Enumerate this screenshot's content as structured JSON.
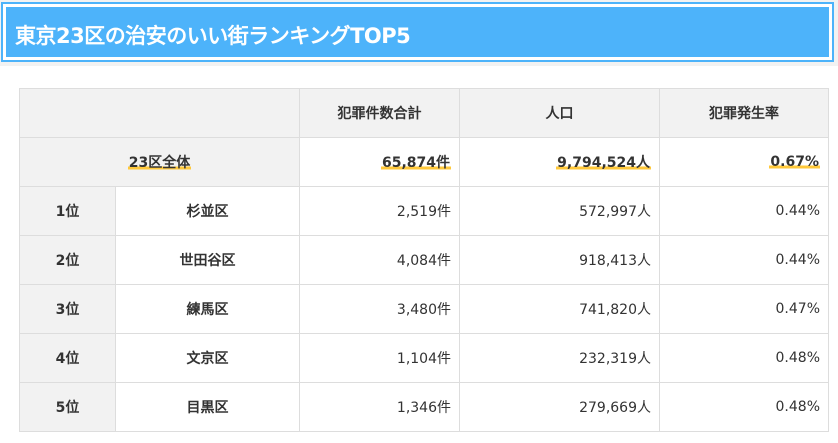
{
  "title": "東京23区の治安のいい街ランキングTOP5",
  "table": {
    "headers": [
      "",
      "犯罪件数合計",
      "人口",
      "犯罪発生率"
    ],
    "total": {
      "label": "23区全体",
      "crimes": "65,874件",
      "population": "9,794,524人",
      "rate": "0.67%"
    },
    "rows": [
      {
        "rank": "1位",
        "ward": "杉並区",
        "crimes": "2,519件",
        "population": "572,997人",
        "rate": "0.44%"
      },
      {
        "rank": "2位",
        "ward": "世田谷区",
        "crimes": "4,084件",
        "population": "918,413人",
        "rate": "0.44%"
      },
      {
        "rank": "3位",
        "ward": "練馬区",
        "crimes": "3,480件",
        "population": "741,820人",
        "rate": "0.47%"
      },
      {
        "rank": "4位",
        "ward": "文京区",
        "crimes": "1,104件",
        "population": "232,319人",
        "rate": "0.48%"
      },
      {
        "rank": "5位",
        "ward": "目黒区",
        "crimes": "1,346件",
        "population": "279,669人",
        "rate": "0.48%"
      }
    ]
  },
  "colors": {
    "title_background": "#4db3fa",
    "highlight_underline": "#ffc83a",
    "header_background": "#f2f2f2"
  }
}
